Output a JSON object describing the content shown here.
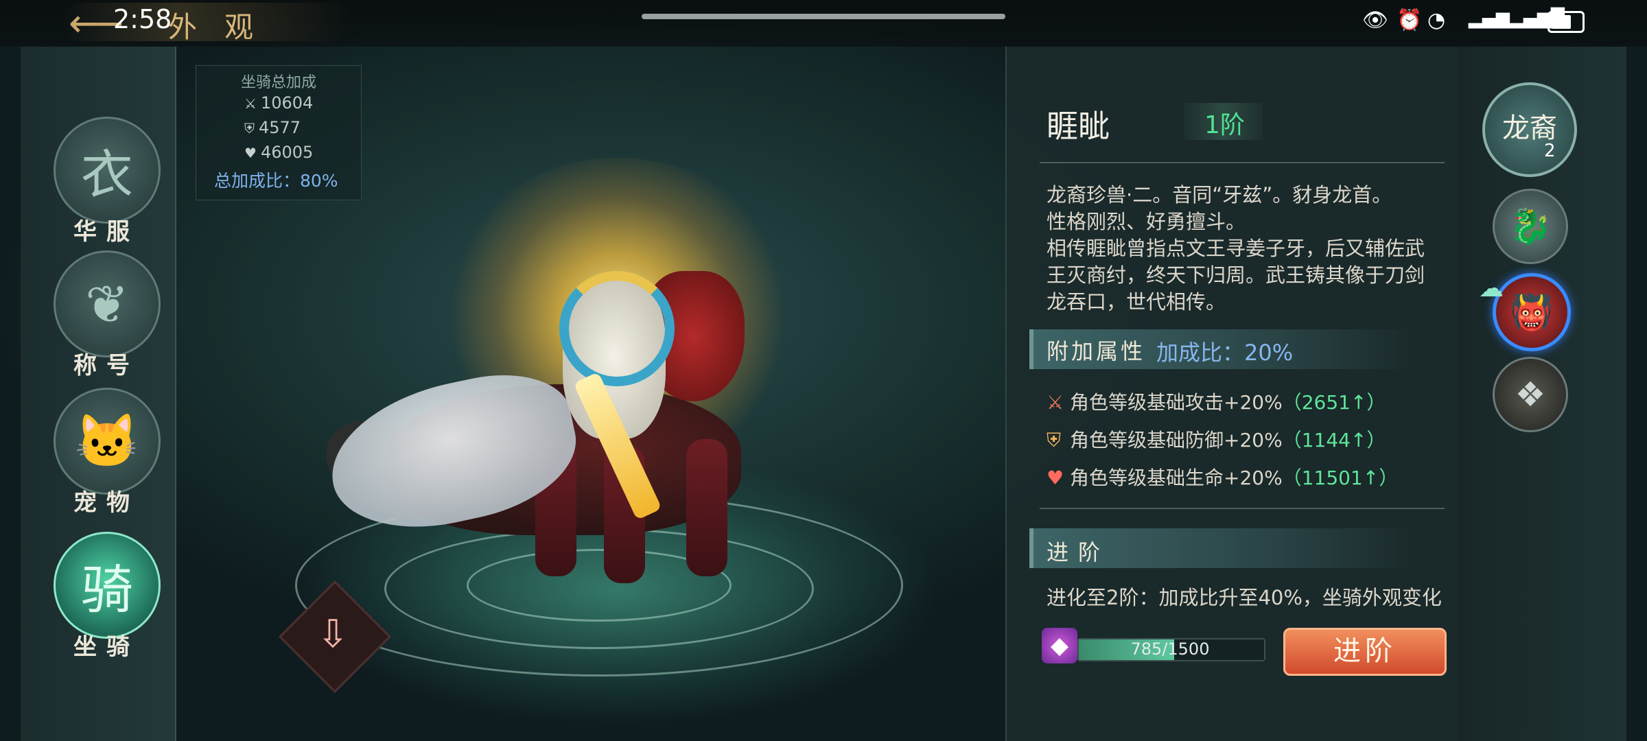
{
  "status_bar": {
    "time": "2:58",
    "icons": [
      "eye-icon",
      "alarm-icon",
      "wifi-icon",
      "signal-4g-icon",
      "signal-5g-icon",
      "battery-icon"
    ]
  },
  "header": {
    "title": "外观",
    "back_icon": "back-arrow-icon"
  },
  "left_nav": {
    "items": [
      {
        "label": "华服",
        "icon": "robe-icon",
        "active": false
      },
      {
        "label": "称号",
        "icon": "emblem-icon",
        "active": false
      },
      {
        "label": "宠物",
        "icon": "pet-cat-icon",
        "active": false
      },
      {
        "label": "坐骑",
        "icon": "mount-icon",
        "active": true
      }
    ]
  },
  "bonus_summary": {
    "title": "坐骑总加成",
    "attack": "10604",
    "defense": "4577",
    "hp": "46005",
    "total_ratio": "总加成比：80%"
  },
  "mount": {
    "name": "睚眦",
    "tier": "1阶",
    "description": "龙裔珍兽·二。音同“牙兹”。豺身龙首。\n性格刚烈、好勇擅斗。\n相传睚眦曾指点文王寻姜子牙，后又辅佐武王灭商纣，终天下归周。武王铸其像于刀剑龙吞口，世代相传。",
    "extra_title": "附加属性",
    "extra_ratio": "加成比：20%",
    "attributes": [
      {
        "icon": "sword-icon",
        "text": "角色等级基础攻击+20%",
        "gain": "（2651↑）"
      },
      {
        "icon": "shield-icon",
        "text": "角色等级基础防御+20%",
        "gain": "（1144↑）"
      },
      {
        "icon": "heart-icon",
        "text": "角色等级基础生命+20%",
        "gain": "（11501↑）"
      }
    ],
    "advance_title": "进阶",
    "advance_desc": "进化至2阶：加成比升至40%，坐骑外观变化",
    "progress_text": "785/1500",
    "progress_fraction": 0.523,
    "advance_button": "进阶"
  },
  "right_strip": {
    "category": "龙裔",
    "category_count": "2",
    "thumbs": [
      {
        "name": "mount-thumb-silver-beast",
        "selected": false
      },
      {
        "name": "mount-thumb-yazi",
        "selected": true
      },
      {
        "name": "mount-thumb-locked",
        "selected": false
      }
    ]
  },
  "colors": {
    "accent_green": "#4fe28f",
    "ratio_blue": "#86b6ee",
    "advance_button": "#d04a2c"
  }
}
